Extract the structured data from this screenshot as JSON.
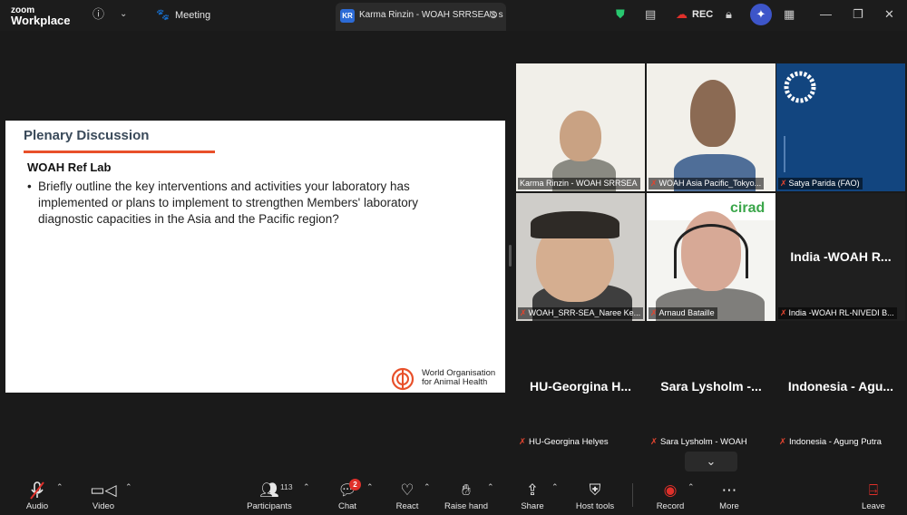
{
  "titlebar": {
    "brand_top": "zoom",
    "brand_bottom": "Workplace",
    "meeting_tab": "Meeting",
    "active_tab_badge": "KR",
    "active_tab_label": "Karma Rinzin - WOAH SRRSEA's s",
    "rec_label": "REC"
  },
  "slide": {
    "title": "Plenary Discussion",
    "subtitle": "WOAH Ref Lab",
    "bullet": "Briefly outline the key interventions and activities your laboratory has implemented or plans to implement to strengthen Members' laboratory diagnostic capacities in the Asia and the Pacific region?",
    "org_line1": "World Organisation",
    "org_line2": "for Animal Health",
    "accent_color": "#e8502a"
  },
  "gallery": {
    "tiles": [
      {
        "name": "Karma Rinzin - WOAH SRRSEA"
      },
      {
        "name": "WOAH Asia Pacific_Tokyo..."
      },
      {
        "name": "Satya Parida (FAO)"
      },
      {
        "name": "WOAH_SRR-SEA_Naree Ke..."
      },
      {
        "name": "Arnaud Bataille",
        "brand": "cirad"
      },
      {
        "big": "India -WOAH R...",
        "name": "India -WOAH RL-NIVEDI B..."
      },
      {
        "big": "HU-Georgina H...",
        "name": "HU-Georgina Helyes"
      },
      {
        "big": "Sara Lysholm -...",
        "name": "Sara Lysholm - WOAH"
      },
      {
        "big": "Indonesia - Agu...",
        "name": "Indonesia - Agung Putra"
      }
    ]
  },
  "toolbar": {
    "audio": "Audio",
    "video": "Video",
    "participants": "Participants",
    "participants_count": "113",
    "chat": "Chat",
    "chat_badge": "2",
    "react": "React",
    "raise_hand": "Raise hand",
    "share": "Share",
    "host_tools": "Host tools",
    "record": "Record",
    "more": "More",
    "leave": "Leave"
  }
}
